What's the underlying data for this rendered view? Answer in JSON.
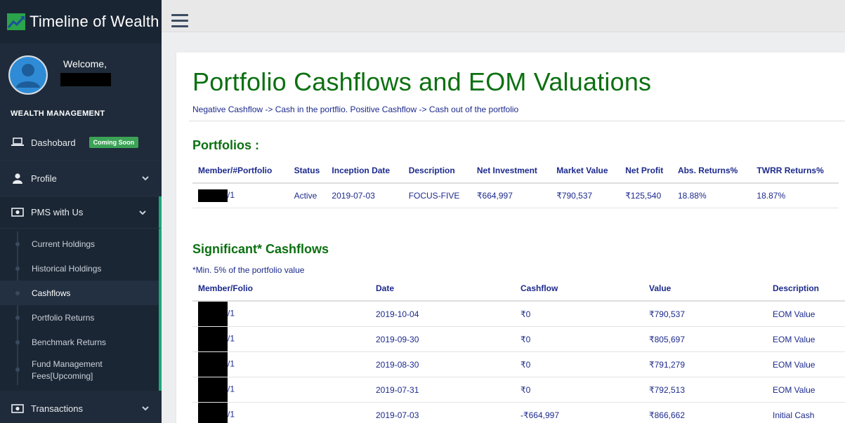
{
  "app": {
    "title": "Timeline of Wealth"
  },
  "user": {
    "welcome": "Welcome,"
  },
  "sidebar": {
    "section_title": "WEALTH MANAGEMENT",
    "items": [
      {
        "label": "Dashobard",
        "icon": "laptop-icon",
        "badge": "Coming Soon"
      },
      {
        "label": "Profile",
        "icon": "user-icon"
      },
      {
        "label": "PMS with Us",
        "icon": "money-icon"
      },
      {
        "label": "Transactions",
        "icon": "money-icon"
      }
    ],
    "subitems": [
      {
        "label": "Current Holdings"
      },
      {
        "label": "Historical Holdings"
      },
      {
        "label": "Cashflows"
      },
      {
        "label": "Portfolio Returns"
      },
      {
        "label": "Benchmark Returns"
      },
      {
        "label": "Fund Management Fees[Upcoming]"
      }
    ]
  },
  "page": {
    "title": "Portfolio Cashflows and EOM Valuations",
    "subtitle": "Negative Cashflow -> Cash in the portflio. Positive Cashflow -> Cash out of the portfolio"
  },
  "portfolios": {
    "heading": "Portfolios :",
    "columns": [
      "Member/#Portfolio",
      "Status",
      "Inception Date",
      "Description",
      "Net Investment",
      "Market Value",
      "Net Profit",
      "Abs. Returns%",
      "TWRR Returns%"
    ],
    "rows": [
      {
        "member": "/1",
        "status": "Active",
        "inception": "2019-07-03",
        "description": "FOCUS-FIVE",
        "net_investment": "₹664,997",
        "market_value": "₹790,537",
        "net_profit": "₹125,540",
        "abs_returns": "18.88%",
        "twrr_returns": "18.87%"
      }
    ]
  },
  "cashflows": {
    "heading": "Significant* Cashflows",
    "note": "*Min. 5% of the portfolio value",
    "columns": [
      "Member/Folio",
      "Date",
      "Cashflow",
      "Value",
      "Description"
    ],
    "rows": [
      {
        "folio": "/1",
        "date": "2019-10-04",
        "cashflow": "₹0",
        "value": "₹790,537",
        "description": "EOM Value"
      },
      {
        "folio": "/1",
        "date": "2019-09-30",
        "cashflow": "₹0",
        "value": "₹805,697",
        "description": "EOM Value"
      },
      {
        "folio": "/1",
        "date": "2019-08-30",
        "cashflow": "₹0",
        "value": "₹791,279",
        "description": "EOM Value"
      },
      {
        "folio": "/1",
        "date": "2019-07-31",
        "cashflow": "₹0",
        "value": "₹792,513",
        "description": "EOM Value"
      },
      {
        "folio": "/1",
        "date": "2019-07-03",
        "cashflow": "-₹664,997",
        "value": "₹866,662",
        "description": "Initial Cash"
      }
    ]
  }
}
